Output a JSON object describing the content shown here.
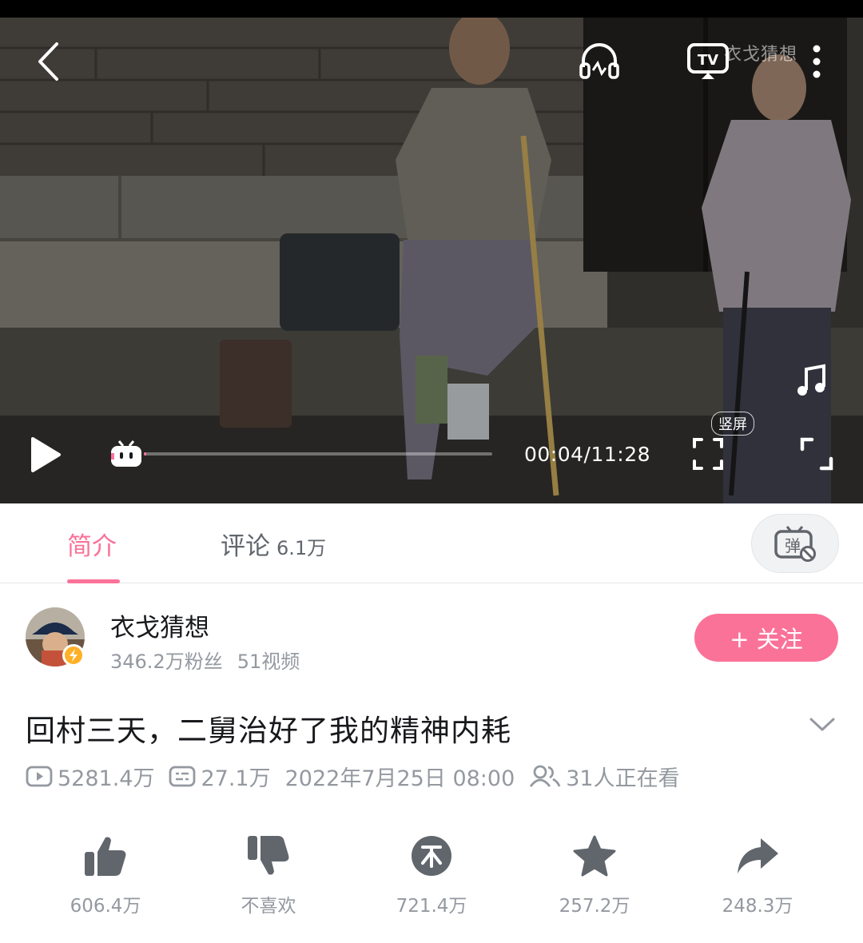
{
  "player": {
    "watermark": "衣戈猜想",
    "current_time": "00:04",
    "duration": "11:28",
    "time_display": "00:04/11:28",
    "progress_fraction": 0.006,
    "portrait_label": "竖屏",
    "icons": [
      "back-icon",
      "headphones-icon",
      "tv-cast-icon",
      "more-icon",
      "music-note-icon",
      "play-icon",
      "bilibili-tv-mascot-icon",
      "portrait-fullscreen-icon",
      "fullscreen-icon"
    ]
  },
  "tabs": {
    "intro": "简介",
    "comments": "评论",
    "comments_count": "6.1万",
    "danmaku_icon": "danmaku-off-icon"
  },
  "uploader": {
    "name": "衣戈猜想",
    "followers": "346.2万粉丝",
    "videos": "51视频",
    "follow_label": "+ 关注"
  },
  "video": {
    "title": "回村三天，二舅治好了我的精神内耗",
    "views": "5281.4万",
    "danmaku": "27.1万",
    "published": "2022年7月25日 08:00",
    "watching": "31人正在看"
  },
  "actions": [
    {
      "icon": "thumbs-up-icon",
      "label": "606.4万"
    },
    {
      "icon": "thumbs-down-icon",
      "label": "不喜欢"
    },
    {
      "icon": "coin-icon",
      "label": "721.4万"
    },
    {
      "icon": "star-icon",
      "label": "257.2万"
    },
    {
      "icon": "share-icon",
      "label": "248.3万"
    }
  ],
  "colors": {
    "accent": "#fb7299",
    "text_primary": "#18191c",
    "text_secondary": "#9499a0",
    "icon_gray": "#61666d"
  }
}
